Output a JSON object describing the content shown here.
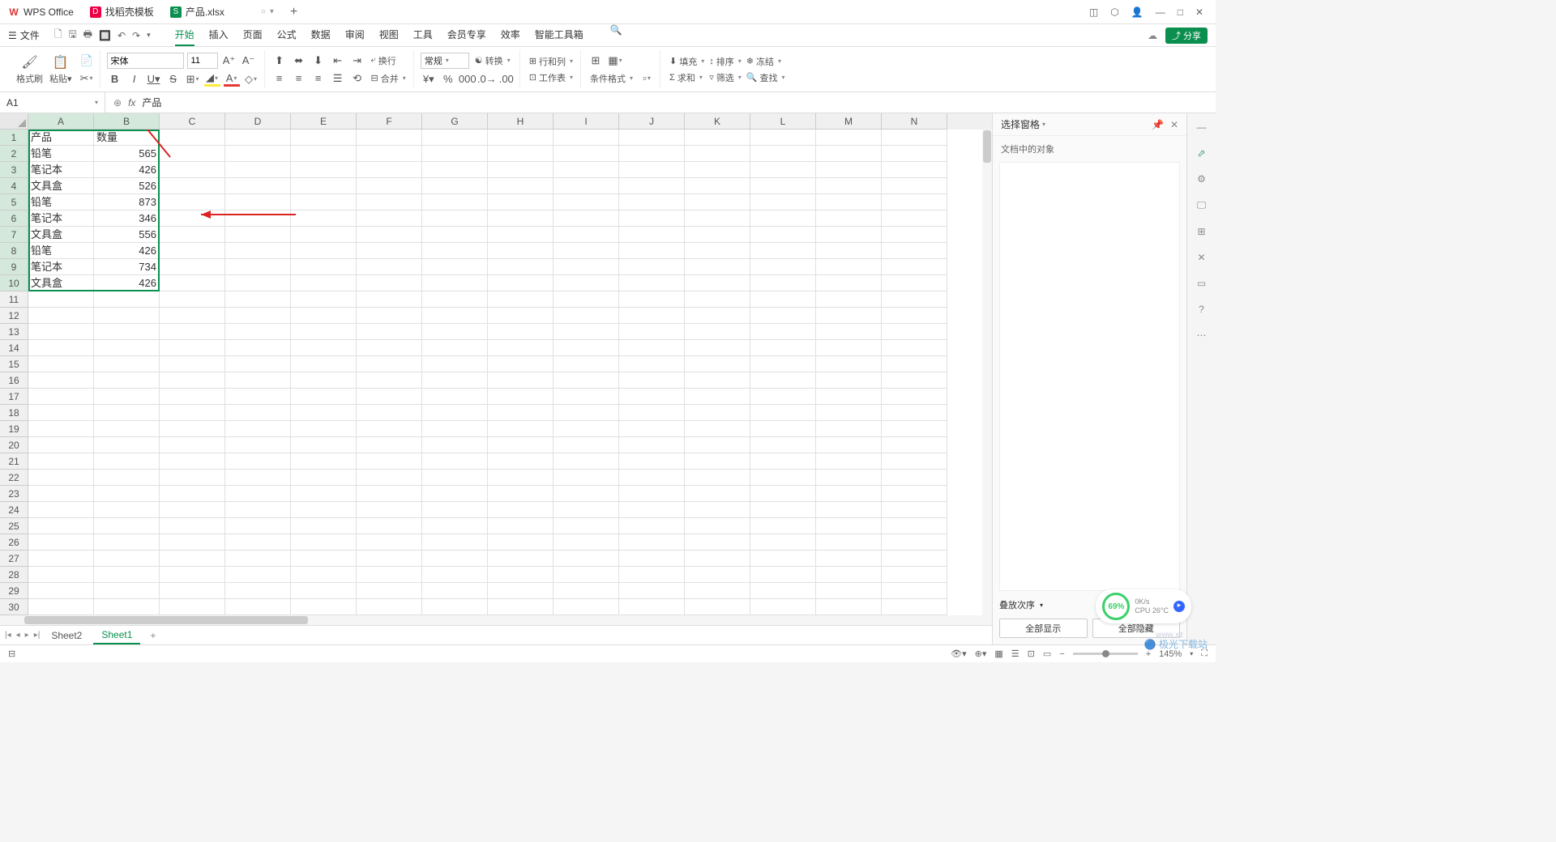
{
  "title_tabs": {
    "wps": "WPS Office",
    "template": "找稻壳模板",
    "doc": "产品.xlsx"
  },
  "menu": {
    "file": "文件",
    "tabs": [
      "开始",
      "插入",
      "页面",
      "公式",
      "数据",
      "审阅",
      "视图",
      "工具",
      "会员专享",
      "效率",
      "智能工具箱"
    ],
    "share": "分享"
  },
  "ribbon": {
    "format_painter": "格式刷",
    "paste": "粘贴",
    "font_name": "宋体",
    "font_size": "11",
    "wrap": "换行",
    "merge": "合并",
    "general": "常规",
    "convert": "转换",
    "row_col": "行和列",
    "worksheet": "工作表",
    "cond_format": "条件格式",
    "fill": "填充",
    "sort": "排序",
    "freeze": "冻结",
    "sum": "求和",
    "filter": "筛选",
    "find": "查找"
  },
  "formula": {
    "cell_ref": "A1",
    "fx": "fx",
    "content": "产品"
  },
  "columns": [
    "A",
    "B",
    "C",
    "D",
    "E",
    "F",
    "G",
    "H",
    "I",
    "J",
    "K",
    "L",
    "M",
    "N"
  ],
  "rows_count": 30,
  "data": [
    {
      "a": "产品",
      "b": "数量"
    },
    {
      "a": "铅笔",
      "b": "565"
    },
    {
      "a": "笔记本",
      "b": "426"
    },
    {
      "a": "文具盒",
      "b": "526"
    },
    {
      "a": "铅笔",
      "b": "873"
    },
    {
      "a": "笔记本",
      "b": "346"
    },
    {
      "a": "文具盒",
      "b": "556"
    },
    {
      "a": "铅笔",
      "b": "426"
    },
    {
      "a": "笔记本",
      "b": "734"
    },
    {
      "a": "文具盒",
      "b": "426"
    }
  ],
  "side_panel": {
    "title": "选择窗格",
    "sub": "文档中的对象",
    "stack": "叠放次序",
    "show_all": "全部显示",
    "hide_all": "全部隐藏"
  },
  "sheet_tabs": {
    "s2": "Sheet2",
    "s1": "Sheet1"
  },
  "status": {
    "zoom": "145%"
  },
  "perf": {
    "pct": "69%",
    "net": "0K/s",
    "cpu": "CPU 26°C"
  },
  "watermark": "极光下载站",
  "watermark2": "www.xz"
}
